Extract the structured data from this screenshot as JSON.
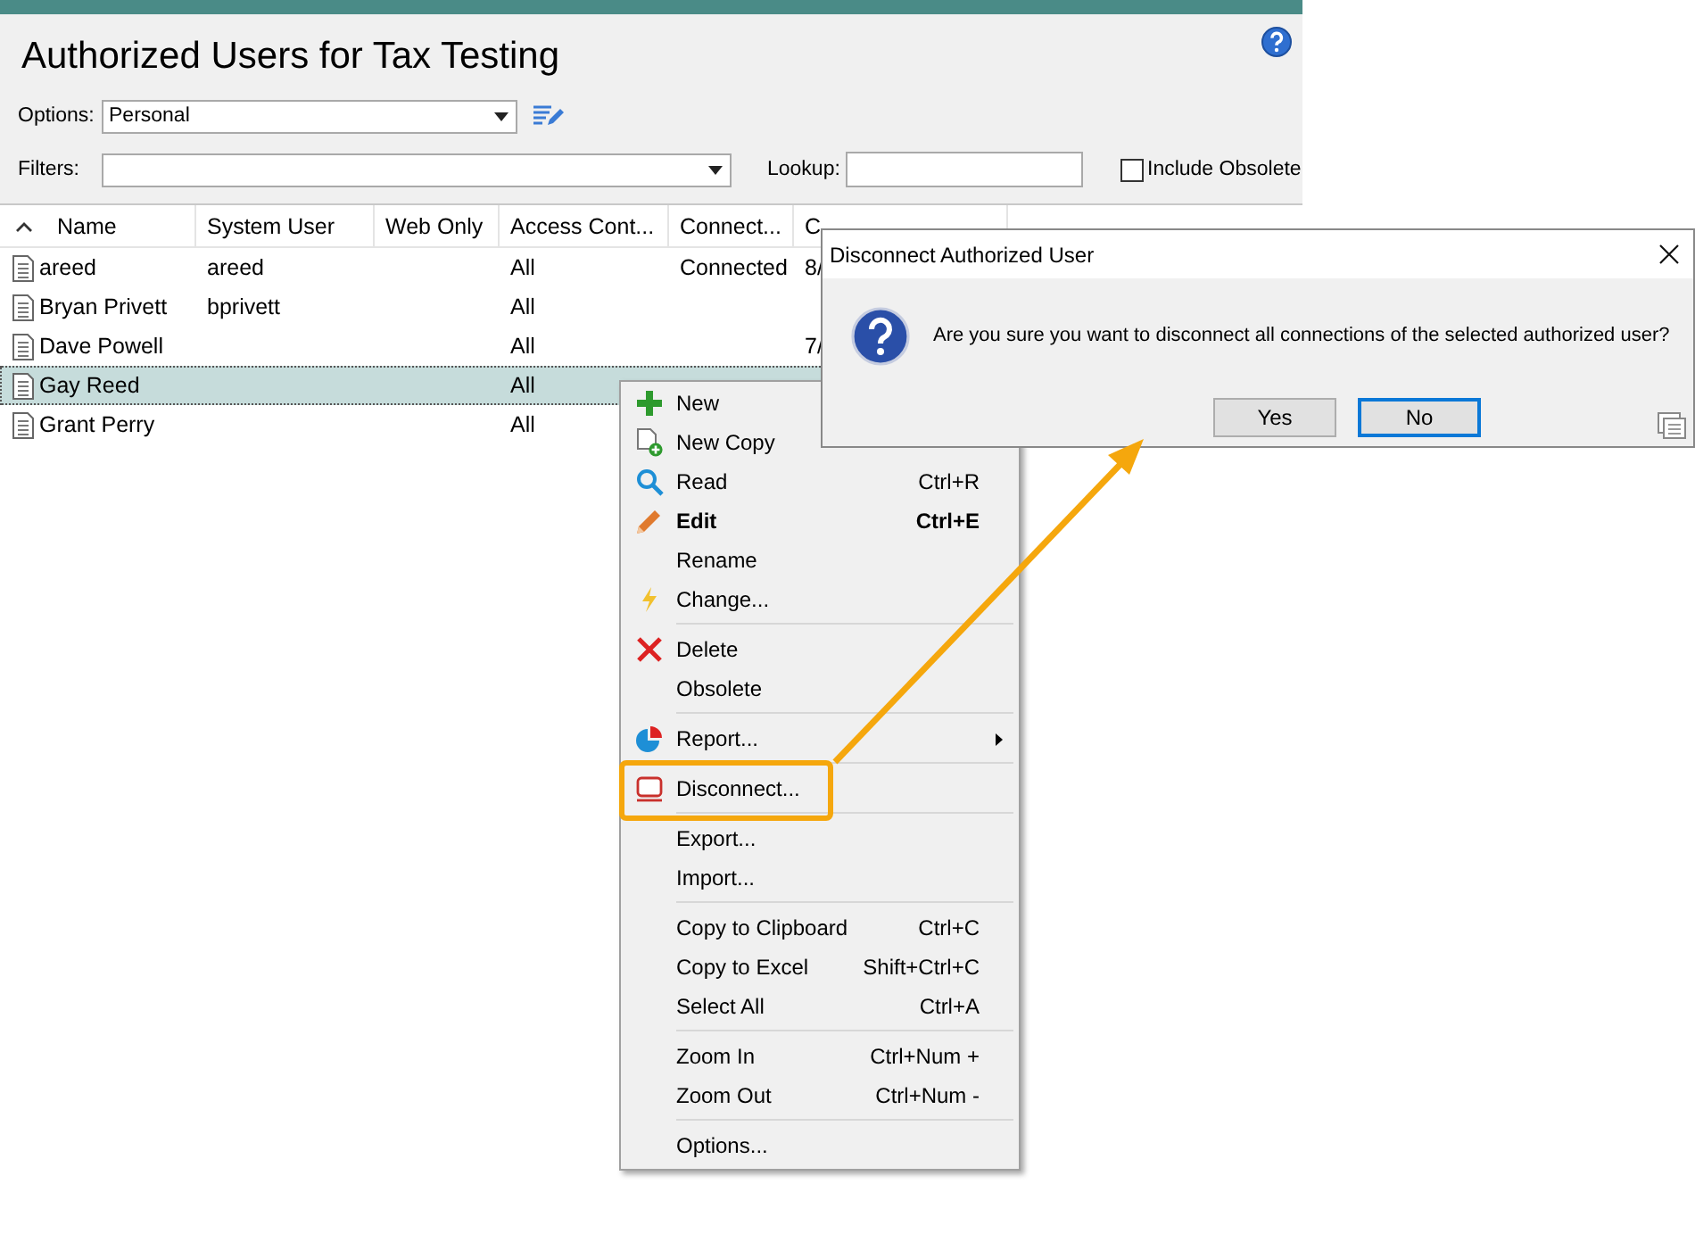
{
  "window": {
    "title": "Authorized Users for Tax Testing"
  },
  "toolbar": {
    "options_label": "Options:",
    "options_value": "Personal",
    "filters_label": "Filters:",
    "lookup_label": "Lookup:",
    "include_obsolete": {
      "label": "Include Obsolete",
      "checked": false
    }
  },
  "grid": {
    "columns": [
      "Name",
      "System User",
      "Web Only",
      "Access Cont...",
      "Connect...",
      "C"
    ],
    "rows": [
      {
        "name": "areed",
        "system_user": "areed",
        "access_control": "All",
        "connection": "Connected",
        "column_6": "8/",
        "selected": false
      },
      {
        "name": "Bryan Privett",
        "system_user": "bprivett",
        "access_control": "All",
        "selected": false
      },
      {
        "name": "Dave Powell",
        "access_control": "All",
        "column_6": "7/",
        "selected": false
      },
      {
        "name": "Gay Reed",
        "access_control": "All",
        "selected": true
      },
      {
        "name": "Grant Perry",
        "access_control": "All",
        "selected": false
      }
    ]
  },
  "context_menu": {
    "items": [
      {
        "kind": "item",
        "label": "New",
        "bold": false,
        "highlighted": false
      },
      {
        "kind": "item",
        "label": "New Copy",
        "bold": false,
        "highlighted": false
      },
      {
        "kind": "item",
        "label": "Read",
        "shortcut": "Ctrl+R",
        "bold": false,
        "submenu": false,
        "highlighted": false
      },
      {
        "kind": "item",
        "label": "Edit",
        "shortcut": "Ctrl+E",
        "bold": true,
        "submenu": false,
        "highlighted": false
      },
      {
        "kind": "item",
        "label": "Rename",
        "bold": false,
        "submenu": false,
        "highlighted": false
      },
      {
        "kind": "item",
        "label": "Change...",
        "bold": false,
        "submenu": false,
        "highlighted": false
      },
      {
        "kind": "separator"
      },
      {
        "kind": "item",
        "label": "Delete",
        "bold": false,
        "submenu": false,
        "highlighted": false
      },
      {
        "kind": "item",
        "label": "Obsolete",
        "bold": false,
        "submenu": false,
        "highlighted": false
      },
      {
        "kind": "separator"
      },
      {
        "kind": "item",
        "label": "Report...",
        "bold": false,
        "submenu": true,
        "highlighted": false
      },
      {
        "kind": "separator"
      },
      {
        "kind": "item",
        "label": "Disconnect...",
        "bold": false,
        "submenu": false,
        "highlighted": true
      },
      {
        "kind": "separator"
      },
      {
        "kind": "item",
        "label": "Export...",
        "bold": false,
        "submenu": false,
        "highlighted": false
      },
      {
        "kind": "item",
        "label": "Import...",
        "bold": false,
        "submenu": false,
        "highlighted": false
      },
      {
        "kind": "separator"
      },
      {
        "kind": "item",
        "label": "Copy to Clipboard",
        "shortcut": "Ctrl+C",
        "bold": false,
        "submenu": false,
        "highlighted": false
      },
      {
        "kind": "item",
        "label": "Copy to Excel",
        "shortcut": "Shift+Ctrl+C",
        "bold": false,
        "submenu": false,
        "highlighted": false
      },
      {
        "kind": "item",
        "label": "Select All",
        "shortcut": "Ctrl+A",
        "bold": false,
        "submenu": false,
        "highlighted": false
      },
      {
        "kind": "separator"
      },
      {
        "kind": "item",
        "label": "Zoom In",
        "shortcut": "Ctrl+Num +",
        "bold": false,
        "submenu": false,
        "highlighted": false
      },
      {
        "kind": "item",
        "label": "Zoom Out",
        "shortcut": "Ctrl+Num -",
        "bold": false,
        "submenu": false,
        "highlighted": false
      },
      {
        "kind": "separator"
      },
      {
        "kind": "item",
        "label": "Options...",
        "bold": false,
        "submenu": false,
        "highlighted": false
      }
    ]
  },
  "dialog": {
    "title": "Disconnect Authorized User",
    "message": "Are you sure you want to disconnect all connections of the selected authorized user?",
    "buttons": [
      {
        "label": "Yes",
        "default": false
      },
      {
        "label": "No",
        "default": true
      }
    ]
  }
}
